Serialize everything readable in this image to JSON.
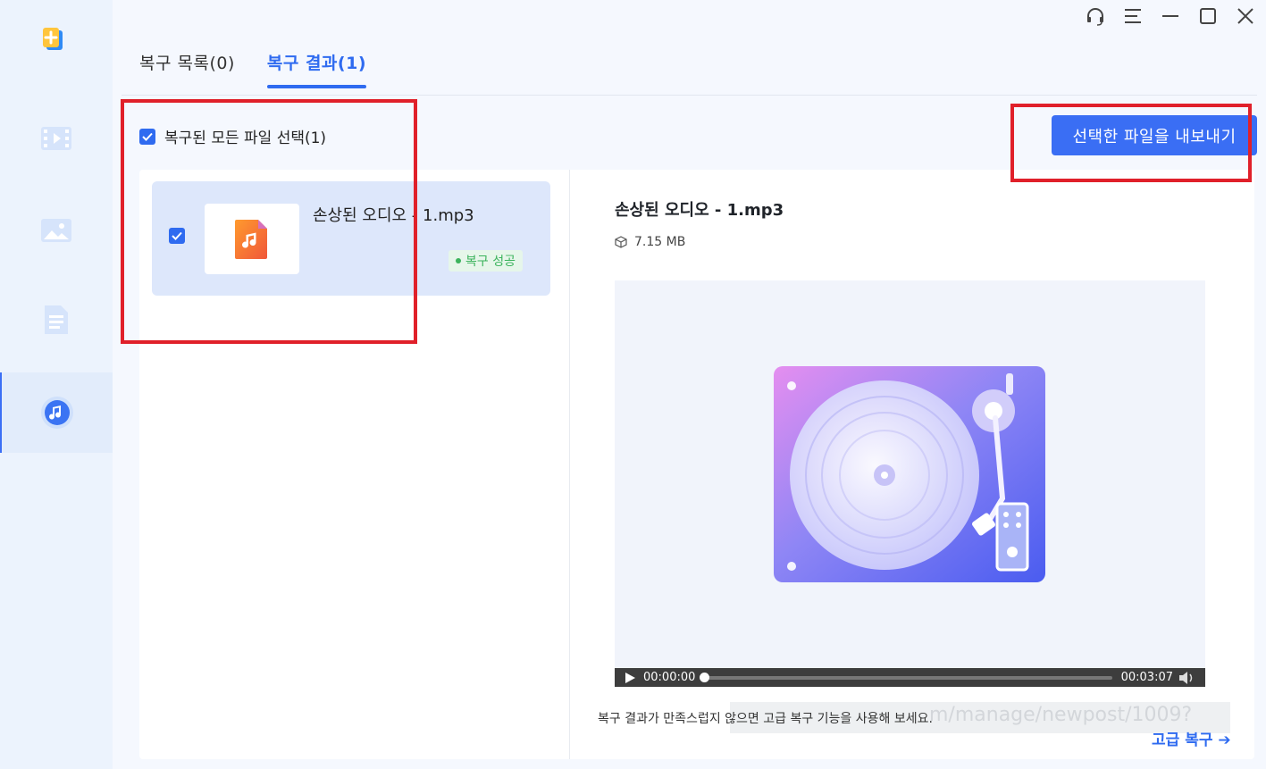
{
  "window": {
    "controls": [
      "headset-icon",
      "menu-icon",
      "minimize-icon",
      "maximize-icon",
      "close-icon"
    ]
  },
  "sidebar": {
    "items": [
      {
        "name": "video",
        "icon": "video-icon"
      },
      {
        "name": "photo",
        "icon": "photo-icon"
      },
      {
        "name": "document",
        "icon": "document-icon"
      },
      {
        "name": "audio",
        "icon": "music-icon",
        "active": true
      }
    ]
  },
  "tabs": [
    {
      "label": "복구 목록(0)",
      "active": false
    },
    {
      "label": "복구 결과(1)",
      "active": true
    }
  ],
  "select_all": {
    "label": "복구된 모든 파일 선택(1)",
    "checked": true
  },
  "export_button": {
    "label": "선택한 파일을 내보내기"
  },
  "file_list": [
    {
      "name": "손상된 오디오 - 1.mp3",
      "status": "복구 성공",
      "checked": true
    }
  ],
  "preview": {
    "file_name": "손상된 오디오 - 1.mp3",
    "size": "7.15 MB",
    "player": {
      "current_time": "00:00:00",
      "duration": "00:03:07",
      "progress": 0
    }
  },
  "hint": {
    "text": "복구 결과가 만족스럽지 않으면 고급 복구 기능을 사용해 보세요.",
    "overlay_url": "m/manage/newpost/1009?"
  },
  "advanced_link": {
    "label": "고급 복구 ➔"
  },
  "colors": {
    "accent": "#2f6bf0",
    "success": "#3bb35c",
    "highlight": "#e0202a"
  }
}
